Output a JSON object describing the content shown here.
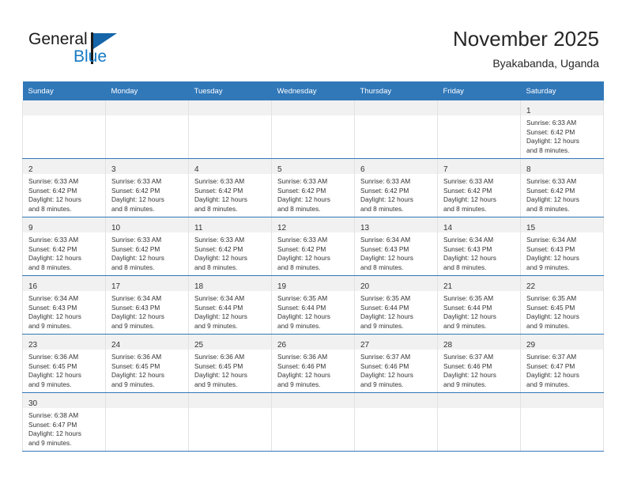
{
  "brand": {
    "name_part1": "General",
    "name_part2": "Blue",
    "logo_icon": "blue-flag-triangle-logo",
    "color_dark": "#1a1a1a",
    "color_blue": "#1579c4"
  },
  "header": {
    "title": "November 2025",
    "subtitle": "Byakabanda, Uganda"
  },
  "theme": {
    "header_row_bg": "#3178b9",
    "date_band_bg": "#f1f1f1",
    "row_divider": "#3178b9",
    "cell_border": "#e2e2e2"
  },
  "weekdays": [
    {
      "label": "Sunday"
    },
    {
      "label": "Monday"
    },
    {
      "label": "Tuesday"
    },
    {
      "label": "Wednesday"
    },
    {
      "label": "Thursday"
    },
    {
      "label": "Friday"
    },
    {
      "label": "Saturday"
    }
  ],
  "weeks": [
    {
      "days": [
        {
          "date": "",
          "empty": true
        },
        {
          "date": "",
          "empty": true
        },
        {
          "date": "",
          "empty": true
        },
        {
          "date": "",
          "empty": true
        },
        {
          "date": "",
          "empty": true
        },
        {
          "date": "",
          "empty": true
        },
        {
          "date": "1",
          "sunrise": "Sunrise: 6:33 AM",
          "sunset": "Sunset: 6:42 PM",
          "daylight_1": "Daylight: 12 hours",
          "daylight_2": "and 8 minutes."
        }
      ]
    },
    {
      "days": [
        {
          "date": "2",
          "sunrise": "Sunrise: 6:33 AM",
          "sunset": "Sunset: 6:42 PM",
          "daylight_1": "Daylight: 12 hours",
          "daylight_2": "and 8 minutes."
        },
        {
          "date": "3",
          "sunrise": "Sunrise: 6:33 AM",
          "sunset": "Sunset: 6:42 PM",
          "daylight_1": "Daylight: 12 hours",
          "daylight_2": "and 8 minutes."
        },
        {
          "date": "4",
          "sunrise": "Sunrise: 6:33 AM",
          "sunset": "Sunset: 6:42 PM",
          "daylight_1": "Daylight: 12 hours",
          "daylight_2": "and 8 minutes."
        },
        {
          "date": "5",
          "sunrise": "Sunrise: 6:33 AM",
          "sunset": "Sunset: 6:42 PM",
          "daylight_1": "Daylight: 12 hours",
          "daylight_2": "and 8 minutes."
        },
        {
          "date": "6",
          "sunrise": "Sunrise: 6:33 AM",
          "sunset": "Sunset: 6:42 PM",
          "daylight_1": "Daylight: 12 hours",
          "daylight_2": "and 8 minutes."
        },
        {
          "date": "7",
          "sunrise": "Sunrise: 6:33 AM",
          "sunset": "Sunset: 6:42 PM",
          "daylight_1": "Daylight: 12 hours",
          "daylight_2": "and 8 minutes."
        },
        {
          "date": "8",
          "sunrise": "Sunrise: 6:33 AM",
          "sunset": "Sunset: 6:42 PM",
          "daylight_1": "Daylight: 12 hours",
          "daylight_2": "and 8 minutes."
        }
      ]
    },
    {
      "days": [
        {
          "date": "9",
          "sunrise": "Sunrise: 6:33 AM",
          "sunset": "Sunset: 6:42 PM",
          "daylight_1": "Daylight: 12 hours",
          "daylight_2": "and 8 minutes."
        },
        {
          "date": "10",
          "sunrise": "Sunrise: 6:33 AM",
          "sunset": "Sunset: 6:42 PM",
          "daylight_1": "Daylight: 12 hours",
          "daylight_2": "and 8 minutes."
        },
        {
          "date": "11",
          "sunrise": "Sunrise: 6:33 AM",
          "sunset": "Sunset: 6:42 PM",
          "daylight_1": "Daylight: 12 hours",
          "daylight_2": "and 8 minutes."
        },
        {
          "date": "12",
          "sunrise": "Sunrise: 6:33 AM",
          "sunset": "Sunset: 6:42 PM",
          "daylight_1": "Daylight: 12 hours",
          "daylight_2": "and 8 minutes."
        },
        {
          "date": "13",
          "sunrise": "Sunrise: 6:34 AM",
          "sunset": "Sunset: 6:43 PM",
          "daylight_1": "Daylight: 12 hours",
          "daylight_2": "and 8 minutes."
        },
        {
          "date": "14",
          "sunrise": "Sunrise: 6:34 AM",
          "sunset": "Sunset: 6:43 PM",
          "daylight_1": "Daylight: 12 hours",
          "daylight_2": "and 8 minutes."
        },
        {
          "date": "15",
          "sunrise": "Sunrise: 6:34 AM",
          "sunset": "Sunset: 6:43 PM",
          "daylight_1": "Daylight: 12 hours",
          "daylight_2": "and 9 minutes."
        }
      ]
    },
    {
      "days": [
        {
          "date": "16",
          "sunrise": "Sunrise: 6:34 AM",
          "sunset": "Sunset: 6:43 PM",
          "daylight_1": "Daylight: 12 hours",
          "daylight_2": "and 9 minutes."
        },
        {
          "date": "17",
          "sunrise": "Sunrise: 6:34 AM",
          "sunset": "Sunset: 6:43 PM",
          "daylight_1": "Daylight: 12 hours",
          "daylight_2": "and 9 minutes."
        },
        {
          "date": "18",
          "sunrise": "Sunrise: 6:34 AM",
          "sunset": "Sunset: 6:44 PM",
          "daylight_1": "Daylight: 12 hours",
          "daylight_2": "and 9 minutes."
        },
        {
          "date": "19",
          "sunrise": "Sunrise: 6:35 AM",
          "sunset": "Sunset: 6:44 PM",
          "daylight_1": "Daylight: 12 hours",
          "daylight_2": "and 9 minutes."
        },
        {
          "date": "20",
          "sunrise": "Sunrise: 6:35 AM",
          "sunset": "Sunset: 6:44 PM",
          "daylight_1": "Daylight: 12 hours",
          "daylight_2": "and 9 minutes."
        },
        {
          "date": "21",
          "sunrise": "Sunrise: 6:35 AM",
          "sunset": "Sunset: 6:44 PM",
          "daylight_1": "Daylight: 12 hours",
          "daylight_2": "and 9 minutes."
        },
        {
          "date": "22",
          "sunrise": "Sunrise: 6:35 AM",
          "sunset": "Sunset: 6:45 PM",
          "daylight_1": "Daylight: 12 hours",
          "daylight_2": "and 9 minutes."
        }
      ]
    },
    {
      "days": [
        {
          "date": "23",
          "sunrise": "Sunrise: 6:36 AM",
          "sunset": "Sunset: 6:45 PM",
          "daylight_1": "Daylight: 12 hours",
          "daylight_2": "and 9 minutes."
        },
        {
          "date": "24",
          "sunrise": "Sunrise: 6:36 AM",
          "sunset": "Sunset: 6:45 PM",
          "daylight_1": "Daylight: 12 hours",
          "daylight_2": "and 9 minutes."
        },
        {
          "date": "25",
          "sunrise": "Sunrise: 6:36 AM",
          "sunset": "Sunset: 6:45 PM",
          "daylight_1": "Daylight: 12 hours",
          "daylight_2": "and 9 minutes."
        },
        {
          "date": "26",
          "sunrise": "Sunrise: 6:36 AM",
          "sunset": "Sunset: 6:46 PM",
          "daylight_1": "Daylight: 12 hours",
          "daylight_2": "and 9 minutes."
        },
        {
          "date": "27",
          "sunrise": "Sunrise: 6:37 AM",
          "sunset": "Sunset: 6:46 PM",
          "daylight_1": "Daylight: 12 hours",
          "daylight_2": "and 9 minutes."
        },
        {
          "date": "28",
          "sunrise": "Sunrise: 6:37 AM",
          "sunset": "Sunset: 6:46 PM",
          "daylight_1": "Daylight: 12 hours",
          "daylight_2": "and 9 minutes."
        },
        {
          "date": "29",
          "sunrise": "Sunrise: 6:37 AM",
          "sunset": "Sunset: 6:47 PM",
          "daylight_1": "Daylight: 12 hours",
          "daylight_2": "and 9 minutes."
        }
      ]
    },
    {
      "days": [
        {
          "date": "30",
          "sunrise": "Sunrise: 6:38 AM",
          "sunset": "Sunset: 6:47 PM",
          "daylight_1": "Daylight: 12 hours",
          "daylight_2": "and 9 minutes."
        },
        {
          "date": "",
          "empty": true
        },
        {
          "date": "",
          "empty": true
        },
        {
          "date": "",
          "empty": true
        },
        {
          "date": "",
          "empty": true
        },
        {
          "date": "",
          "empty": true
        },
        {
          "date": "",
          "empty": true
        }
      ]
    }
  ]
}
